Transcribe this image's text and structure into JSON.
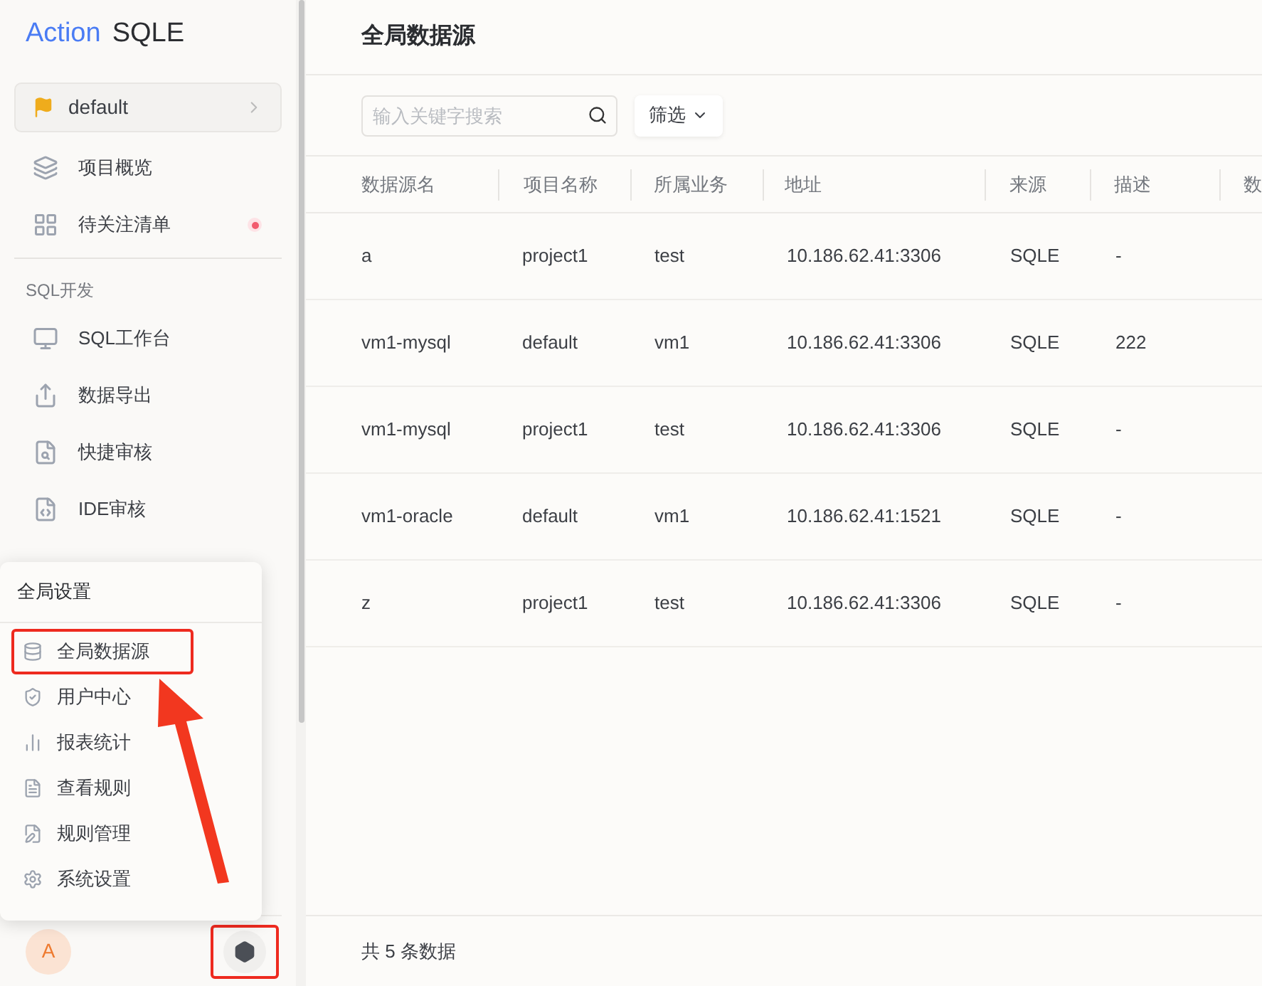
{
  "logo": {
    "brand": "Action",
    "product": "SQLE"
  },
  "project_switcher": {
    "label": "default"
  },
  "sidebar": {
    "items": [
      {
        "kind": "item",
        "label": "项目概览",
        "badge": false
      },
      {
        "kind": "item",
        "label": "待关注清单",
        "badge": true
      },
      {
        "kind": "section",
        "label": "SQL开发"
      },
      {
        "kind": "item",
        "label": "SQL工作台",
        "badge": false
      },
      {
        "kind": "item",
        "label": "数据导出",
        "badge": false
      },
      {
        "kind": "item",
        "label": "快捷审核",
        "badge": false
      },
      {
        "kind": "item",
        "label": "IDE审核",
        "badge": false
      }
    ]
  },
  "settings_menu": {
    "title": "全局设置",
    "items": [
      {
        "label": "全局数据源",
        "highlighted": true
      },
      {
        "label": "用户中心",
        "highlighted": false
      },
      {
        "label": "报表统计",
        "highlighted": false
      },
      {
        "label": "查看规则",
        "highlighted": false
      },
      {
        "label": "规则管理",
        "highlighted": false
      },
      {
        "label": "系统设置",
        "highlighted": false
      }
    ]
  },
  "user": {
    "avatar": "A"
  },
  "settings_button": {
    "highlighted": true
  },
  "page": {
    "title": "全局数据源"
  },
  "search": {
    "placeholder": "输入关键字搜索"
  },
  "filter_button": {
    "label": "筛选"
  },
  "table": {
    "columns": [
      "数据源名",
      "项目名称",
      "所属业务",
      "地址",
      "来源",
      "描述",
      "数"
    ],
    "rows": [
      [
        "a",
        "project1",
        "test",
        "10.186.62.41:3306",
        "SQLE",
        "-"
      ],
      [
        "vm1-mysql",
        "default",
        "vm1",
        "10.186.62.41:3306",
        "SQLE",
        "222"
      ],
      [
        "vm1-mysql",
        "project1",
        "test",
        "10.186.62.41:3306",
        "SQLE",
        "-"
      ],
      [
        "vm1-oracle",
        "default",
        "vm1",
        "10.186.62.41:1521",
        "SQLE",
        "-"
      ],
      [
        "z",
        "project1",
        "test",
        "10.186.62.41:3306",
        "SQLE",
        "-"
      ]
    ]
  },
  "footer": {
    "total": "共 5 条数据"
  }
}
